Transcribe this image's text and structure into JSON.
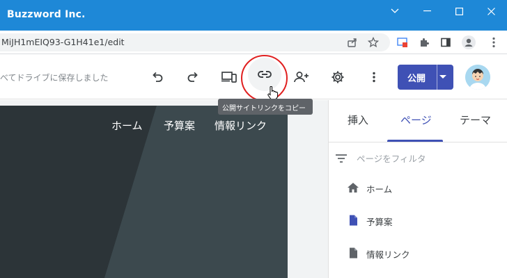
{
  "window": {
    "title": "Buzzword Inc.",
    "controls": [
      "chevron-down-icon",
      "minimize-icon",
      "maximize-icon",
      "close-icon"
    ]
  },
  "address": {
    "url": "MiJH1mEIQ93-G1H41e1/edit",
    "icons": [
      "share-icon",
      "star-icon",
      "extension-cast-icon",
      "puzzle-icon",
      "sidepanel-icon",
      "profile-icon",
      "kebab-menu-icon"
    ]
  },
  "toolbar": {
    "save_status": "べてドライブに保存しました",
    "icons": [
      "undo-icon",
      "redo-icon",
      "preview-devices-icon",
      "link-icon",
      "add-person-icon",
      "gear-icon",
      "more-vert-icon"
    ],
    "publish_label": "公開",
    "tooltip": "公開サイトリンクをコピー",
    "accent": "#3f51b5",
    "annotation_color": "#e02020"
  },
  "site_preview": {
    "nav": [
      "ホーム",
      "予算案",
      "情報リンク"
    ]
  },
  "panel": {
    "tabs": [
      "挿入",
      "ページ",
      "テーマ"
    ],
    "active_tab": "ページ",
    "filter_placeholder": "ページをフィルタ",
    "pages": [
      {
        "label": "ホーム",
        "icon": "home-icon"
      },
      {
        "label": "予算案",
        "icon": "page-icon",
        "selected": true
      },
      {
        "label": "情報リンク",
        "icon": "page-icon"
      }
    ]
  }
}
